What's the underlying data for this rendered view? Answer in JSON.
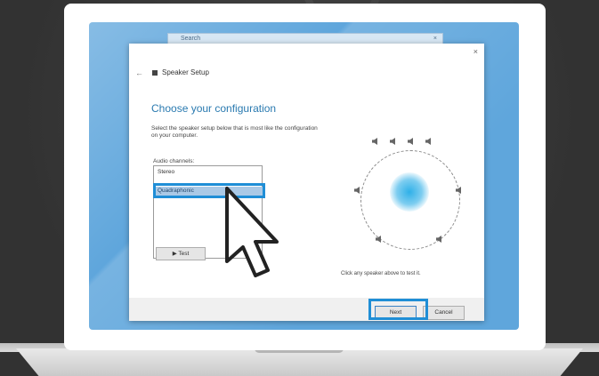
{
  "browser": {
    "tab_label": "Search",
    "tab_close": "×"
  },
  "dialog": {
    "close": "×",
    "back": "←",
    "title": "Speaker Setup",
    "heading": "Choose your configuration",
    "description": "Select the speaker setup below that is most like the configuration on your computer.",
    "channels_label": "Audio channels:",
    "options": [
      "Stereo",
      "Quadraphonic"
    ],
    "selected_index": 1,
    "test_button": "▶ Test",
    "hint": "Click any speaker above to test it.",
    "next_button": "Next",
    "cancel_button": "Cancel"
  },
  "colors": {
    "accent": "#1f8ed6",
    "screen": "#5fa6dc",
    "heading": "#2a7ab0"
  },
  "icons": [
    "speaker-icon",
    "close-icon",
    "back-arrow-icon",
    "mouse-pointer-icon"
  ]
}
